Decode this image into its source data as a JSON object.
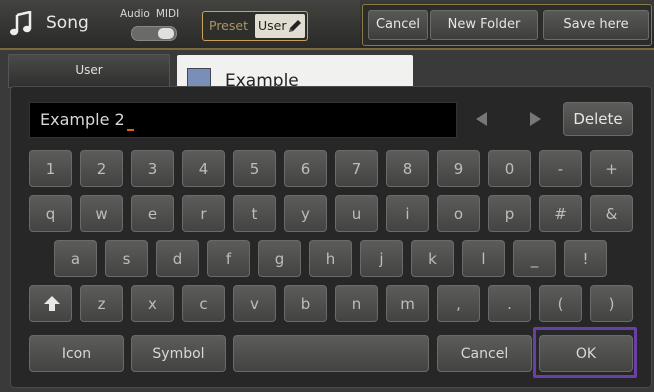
{
  "header": {
    "song_label": "Song",
    "audio_label": "Audio",
    "midi_label": "MIDI",
    "preset_label": "Preset",
    "user_label": "User",
    "cancel_label": "Cancel",
    "new_folder_label": "New Folder",
    "save_here_label": "Save here"
  },
  "background": {
    "sidebar_tab": "User",
    "file_name": "Example"
  },
  "keyboard": {
    "name_value": "Example 2",
    "delete_label": "Delete",
    "row1": [
      "1",
      "2",
      "3",
      "4",
      "5",
      "6",
      "7",
      "8",
      "9",
      "0",
      "-",
      "+"
    ],
    "row2": [
      "q",
      "w",
      "e",
      "r",
      "t",
      "y",
      "u",
      "i",
      "o",
      "p",
      "#",
      "&"
    ],
    "row3": [
      "a",
      "s",
      "d",
      "f",
      "g",
      "h",
      "j",
      "k",
      "l",
      "_",
      "!"
    ],
    "row4": [
      "z",
      "x",
      "c",
      "v",
      "b",
      "n",
      "m",
      ",",
      ".",
      "(",
      ")"
    ],
    "icon_label": "Icon",
    "symbol_label": "Symbol",
    "cancel_label": "Cancel",
    "ok_label": "OK"
  },
  "colors": {
    "accent_gold": "#c8a35a",
    "ok_highlight": "#6a3fa8",
    "caret": "#e06020"
  }
}
